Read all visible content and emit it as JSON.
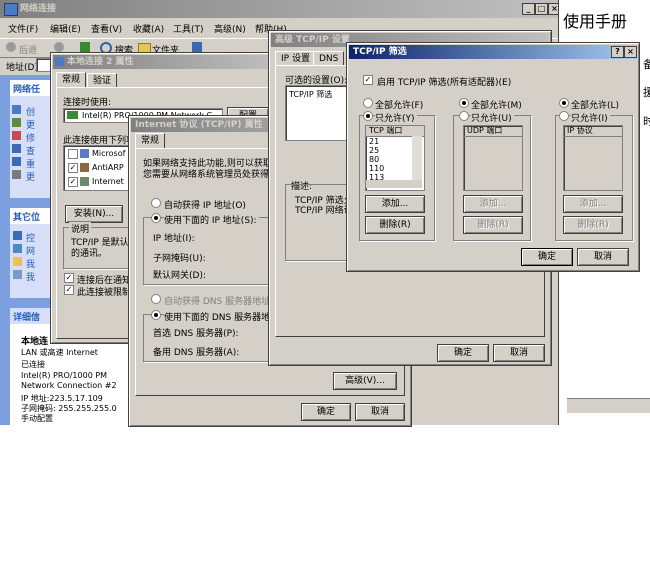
{
  "explorer": {
    "title": "网络连接",
    "menu": [
      "文件(F)",
      "编辑(E)",
      "查看(V)",
      "收藏(A)",
      "工具(T)",
      "高级(N)",
      "帮助(H)"
    ],
    "toolbar": {
      "back": "后退",
      "search": "搜索",
      "folders": "文件夹"
    },
    "address_label": "地址(D)",
    "side_tasks_header": "网络任",
    "side_task_items": [
      "创",
      "更",
      "修",
      "查",
      "重",
      "更"
    ],
    "other_header": "其它位",
    "other_items": [
      "控",
      "网",
      "我",
      "我"
    ],
    "details_header": "详细信",
    "details": {
      "name": "本地连",
      "type": "LAN 或高速 Internet",
      "status": "已连接",
      "device1": "Intel(R) PRO/1000 PM",
      "device2": "Network Connection #2",
      "ip": "IP 地址:223.5.17.109",
      "mask": "子网掩码: 255.255.255.0",
      "assign": "手动配置"
    }
  },
  "background_text": {
    "manual": "使用手册",
    "frag1": "备",
    "frag2": "援",
    "frag3": "时"
  },
  "local_props": {
    "title": "本地连接 2 属性",
    "tabs": [
      "常规",
      "验证"
    ],
    "connect_using": "连接时使用:",
    "adapter": "Intel(R) PRO/1000 PM Network C",
    "configure": "配置",
    "uses_items": "此连接使用下列项",
    "items": [
      "Microsof",
      "AntiARP",
      "Internet"
    ],
    "install": "安装(N)...",
    "desc_header": "说明",
    "desc_text1": "TCP/IP 是默认",
    "desc_text2": "的通讯。",
    "show_icon": "连接后在通知",
    "notify_limited": "此连接被限制"
  },
  "tcpip_props": {
    "title": "Internet 协议 (TCP/IP) 属性",
    "tab": "常规",
    "info1": "如果网络支持此功能,则可以获取",
    "info2": "您需要从网络系统管理员处获得适",
    "auto_ip": "自动获得 IP 地址(O)",
    "use_ip": "使用下面的 IP 地址(S):",
    "ip_label": "IP 地址(I):",
    "mask_label": "子网掩码(U):",
    "gateway_label": "默认网关(D):",
    "auto_dns": "自动获得 DNS 服务器地址",
    "use_dns": "使用下面的 DNS 服务器地址",
    "preferred_dns": "首选 DNS 服务器(P):",
    "alternate_dns": "备用 DNS 服务器(A):",
    "advanced": "高级(V)...",
    "ok": "确定",
    "cancel": "取消"
  },
  "adv_tcpip": {
    "title": "高级 TCP/IP 设置",
    "tabs": [
      "IP 设置",
      "DNS"
    ],
    "optional_settings": "可选的设置(O):",
    "list_item": "TCP/IP 筛选",
    "desc_label": "描述:",
    "desc1": "TCP/IP 筛选允",
    "desc2": "TCP/IP 网络访",
    "ok": "确定",
    "cancel": "取消"
  },
  "filter": {
    "title": "TCP/IP 筛选",
    "enable": "启用 TCP/IP 筛选(所有适配器)(E)",
    "permit_all": "全部允许(F)",
    "permit_only": "只允许(Y)",
    "permit_all_udp": "全部允许(M)",
    "permit_only_udp": "只允许(U)",
    "permit_all_ip": "全部允许(L)",
    "permit_only_ip": "只允许(I)",
    "tcp_header": "TCP 端口",
    "udp_header": "UDP 端口",
    "ip_header": "IP 协议",
    "tcp_ports": [
      "21",
      "25",
      "80",
      "110",
      "113"
    ],
    "add": "添加...",
    "remove": "删除(R)",
    "ok": "确定",
    "cancel": "取消"
  }
}
